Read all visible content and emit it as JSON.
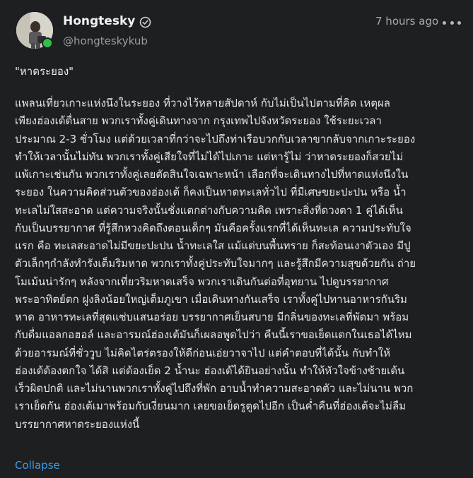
{
  "post": {
    "display_name": "Hongtesky",
    "handle": "@hongteskykub",
    "timestamp": "7 hours ago",
    "title": "\"หาดระยอง\"",
    "body_lines": [
      "แพลนเที่ยวเกาะแห่งนึงในระยอง ที่วางไว้หลายสัปดาห์ กับไม่เป็นไปตามที่คิด เหตุผล",
      "เพียงฮ่องเต้ตื่นสาย พวกเราทั้งคู่เดินทางจาก กรุงเทพไปจังหวัดระยอง ใช้ระยะเวลา",
      "ประมาณ 2-3 ชั่วโมง แต่ด้วยเวลาที่กว่าจะไปถึงท่าเรือบวกกับเวลาขากลับจากเกาะระยอง",
      "ทำให้เวลานั้นไม่ทัน พวกเราทั้งคู่เสียใจที่ไม่ได้ไปเกาะ แต่หารู้ไม่ ว่าหาดระยองก็สวยไม่",
      "แพ้เกาะเช่นกัน พวกเราทั้งคู่เลยตัดสินใจเฉพาะหน้า เลือกที่จะเดินทางไปที่หาดแห่งนึงใน",
      "ระยอง ในความคิดส่วนตัวของฮ่องเต้ ก็คงเป็นหาดทะเลทั่วไป ที่มีเศษขยะปะปน หรือ น้ำ",
      "ทะเลไม่ใสสะอาด แต่ความจริงนั้นชั่งแตกต่างกับความคิด เพราะสิ่งที่ดวงตา 1 คู่ได้เห็น",
      "กับเป็นบรรยากาศ ที่รู้สึกหวงคิดถึงตอนเด็กๆ มันคือครั้งแรกที่ได้เห็นทะเล ความประทับใจ",
      "แรก คือ ทะเลสะอาดไม่มีขยะปะปน น้ำทะเลใส แม้แต่บนพื้นทราย ก็สะท้อนเงาตัวเอง มีปู",
      "ตัวเล็กๆกำลังทำรังเต็มริมหาด พวกเราทั้งคู่ประทับใจมากๆ และรู้สึกมีความสุขด้วยกัน ถ่าย",
      "โมเม้นน่ารักๆ หลังจากเที่ยวริมหาดเสร็จ พวกเราเดินกันต่อที่อุทยาน ไปดูบรรยากาศ",
      "พระอาทิตย์ตก ฝูงลิงน้อยใหญ่เต็มภูเขา เมื่อเดินทางกันเสร็จ เราทั้งคู่ไปทานอาหารกันริม",
      "หาด อาหารทะเลที่สุดแซ่บแสนอร่อย บรรยากาศเย็นสบาย มีกลิ่นของทะเลที่พัดมา พร้อม",
      "กับดื่มแอลกอฮอล์ และอารมณ์ฮ่องเต้มันก็เผลอพูดไปว่า คืนนี้เราขอเย็ดแตกในเธอได้ไหม",
      "ด้วยอารมณ์ที่ชั่ววูบ ไม่คิดไตร่ตรองให้ดีก่อนเอ่ยวาจาไป แต่คำตอบที่ได้นั้น กับทำให้",
      "ฮ่องเต้ต้องตกใจ ได้สิ แต่ต้องเย็ด 2 น้ำนะ ฮ่องเต้ได้ยินอย่างนั้น ทำให้หัวใจข้างซ้ายเต้น",
      "เร็วผิดปกติ และไม่นานพวกเราทั้งคู่ไปถึงที่พัก อาบน้ำทำความสะอาดตัว และไม่นาน พวก",
      "เราเย็ดกัน ฮ่องเต้เมาพร้อมกับเงี่ยนมาก เลยขอเย็ดรูตูดไปอีก เป็นค่ำคืนที่ฮ่องเต้จะไม่ลืม",
      "บรรยากาศหาดระยองแห่งนี้"
    ],
    "collapse_label": "Collapse"
  },
  "icons": {
    "verified": "verified-badge-icon",
    "more": "more-options-icon"
  },
  "colors": {
    "background": "#1e1f21",
    "link": "#3d9ae6",
    "online": "#2fbf4a"
  }
}
